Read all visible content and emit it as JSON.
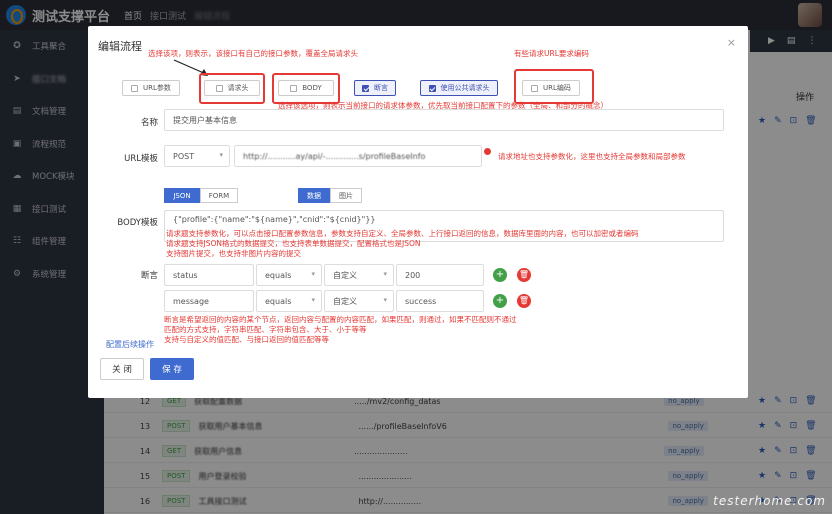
{
  "topbar": {
    "app_title": "测试支撑平台",
    "breadcrumb": [
      "首页",
      "接口测试",
      "编辑流程"
    ]
  },
  "sidebar": {
    "items": [
      {
        "icon": "gear-icon",
        "label": "工具聚合"
      },
      {
        "icon": "send-icon",
        "label": "接口文档"
      },
      {
        "icon": "document-icon",
        "label": "文档管理"
      },
      {
        "icon": "flow-icon",
        "label": "流程规范"
      },
      {
        "icon": "cloud-icon",
        "label": "MOCK模块"
      },
      {
        "icon": "grid-icon",
        "label": "接口测试"
      },
      {
        "icon": "sitemap-icon",
        "label": "组件管理"
      },
      {
        "icon": "cog-icon",
        "label": "系统管理"
      }
    ]
  },
  "table_bg": {
    "op_header": "操作",
    "rows": [
      {
        "num": "12",
        "method": "GET",
        "name": "获取配置数据",
        "path": "...../mv2/config_datas",
        "tag": "no_apply"
      },
      {
        "num": "13",
        "method": "POST",
        "name": "获取用户基本信息",
        "path": "....../profileBaseInfoV6",
        "tag": "no_apply"
      },
      {
        "num": "14",
        "method": "GET",
        "name": "获取用户信息",
        "path": ".....................",
        "tag": "no_apply"
      },
      {
        "num": "15",
        "method": "POST",
        "name": "用户登录校验",
        "path": ".....................",
        "tag": "no_apply"
      },
      {
        "num": "16",
        "method": "POST",
        "name": "工具接口测试",
        "path": "http://...............",
        "tag": "no_apply"
      }
    ]
  },
  "dialog": {
    "title": "编辑流程",
    "close": "×",
    "options": [
      {
        "label": "URL参数",
        "checked": false
      },
      {
        "label": "请求头",
        "checked": false
      },
      {
        "label": "BODY",
        "checked": false
      },
      {
        "label": "断言",
        "checked": true
      },
      {
        "label": "使用公共请求头",
        "checked": true
      },
      {
        "label": "URL编码",
        "checked": false
      }
    ],
    "notes": {
      "header_note": "选择该项，则表示，该接口有自己的接口参数，覆盖全局请求头",
      "url_encode_note": "有些请求URL要求编码",
      "body_note": "选择该选项，则表示当前接口的请求体参数，优先取当前接口配置下的参数（全局、和部分的概念）",
      "url_note": "请求地址也支持参数化，这里也支持全局参数和局部参数",
      "body_tpl_note_1": "请求题支持参数化，可以点击接口配置参数信息，参数支持自定义、全局参数、上行接口返回的信息，数据库里面的内容，也可以加密或者编码",
      "body_tpl_note_2": "请求题支持JSON格式的数据提交，也支持表单数据提交，配置格式也是JSON",
      "body_tpl_note_3": "支持图片提交，也支持非图片内容的提交",
      "assert_note_1": "断言是希望返回的内容的某个节点，返回内容与配置的内容匹配，如果匹配，则通过，如果不匹配则不通过",
      "assert_note_2": "匹配的方式支持，字符串匹配、字符串包含、大于、小于等等",
      "assert_note_3": "支持与自定义的值匹配、与接口返回的值匹配等等"
    },
    "name_label": "名称",
    "name_value": "提交用户基本信息",
    "url_label": "URL模板",
    "method": "POST",
    "url_value": "http://...........ay/api/-.............s/profileBaseInfo",
    "body_label": "BODY模板",
    "body_tabs": [
      "JSON",
      "FORM"
    ],
    "data_tabs": [
      "数据",
      "图片"
    ],
    "body_value": "{\"profile\":{\"name\":\"${name}\",\"cnid\":\"${cnid}\"}}",
    "assert_label": "断言",
    "assertions": [
      {
        "field": "status",
        "op": "equals",
        "type": "自定义",
        "value": "200"
      },
      {
        "field": "message",
        "op": "equals",
        "type": "自定义",
        "value": "success"
      }
    ],
    "followup_link": "配置后续操作",
    "close_button": "关 闭",
    "save_button": "保 存"
  },
  "watermark": "testerhome.com",
  "colors": {
    "accent": "#3f6bd0",
    "annotation": "#e53935",
    "sidebar": "#2f3542"
  }
}
